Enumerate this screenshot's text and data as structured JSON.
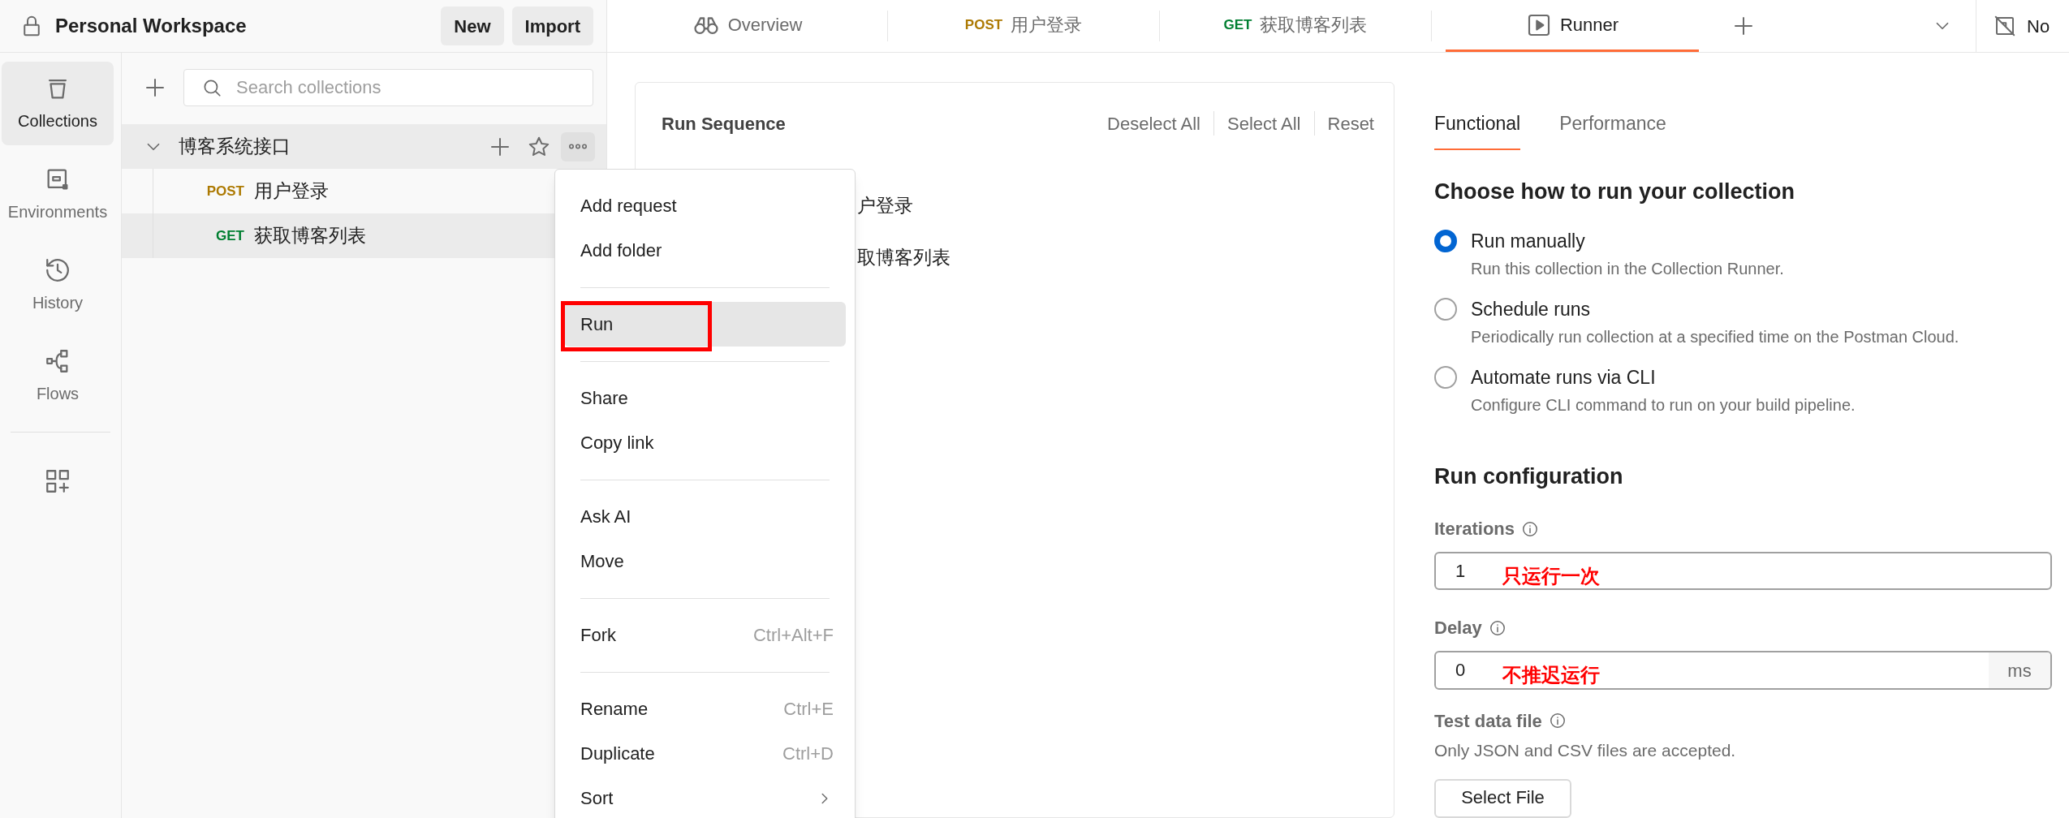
{
  "workspace": {
    "title": "Personal Workspace",
    "buttons": [
      "New",
      "Import"
    ]
  },
  "tabs": [
    {
      "kind": "overview",
      "label": "Overview",
      "selected": false
    },
    {
      "kind": "request",
      "method": "POST",
      "label": "用户登录",
      "selected": false
    },
    {
      "kind": "request",
      "method": "GET",
      "label": "获取博客列表",
      "selected": false
    },
    {
      "kind": "runner",
      "label": "Runner",
      "selected": true
    }
  ],
  "environment": {
    "label": "No"
  },
  "sidebar": {
    "items": [
      {
        "kind": "collections",
        "label": "Collections",
        "selected": true
      },
      {
        "kind": "environments",
        "label": "Environments",
        "selected": false
      },
      {
        "kind": "history",
        "label": "History",
        "selected": false
      },
      {
        "kind": "flows",
        "label": "Flows",
        "selected": false
      },
      {
        "kind": "apps",
        "selected": false
      }
    ]
  },
  "collections": {
    "search": {
      "placeholder": "Search collections"
    },
    "tree": [
      {
        "name": "博客系统接口",
        "expanded": true,
        "selected": true,
        "children": [
          {
            "method": "POST",
            "name": "用户登录",
            "selected": false
          },
          {
            "method": "GET",
            "name": "获取博客列表",
            "selected": true
          }
        ]
      }
    ]
  },
  "context_menu": {
    "groups": [
      [
        {
          "label": "Add request",
          "highlighted": false,
          "marked": false
        },
        {
          "label": "Add folder",
          "highlighted": false,
          "marked": false
        }
      ],
      [
        {
          "label": "Run",
          "highlighted": true,
          "marked": true
        }
      ],
      [
        {
          "label": "Share",
          "highlighted": false,
          "marked": false
        },
        {
          "label": "Copy link",
          "highlighted": false,
          "marked": false
        }
      ],
      [
        {
          "label": "Ask AI",
          "highlighted": false,
          "marked": false
        },
        {
          "label": "Move",
          "highlighted": false,
          "marked": false
        }
      ],
      [
        {
          "label": "Fork",
          "shortcut": "Ctrl+Alt+F",
          "highlighted": false,
          "marked": false
        }
      ],
      [
        {
          "label": "Rename",
          "shortcut": "Ctrl+E",
          "highlighted": false,
          "marked": false
        },
        {
          "label": "Duplicate",
          "shortcut": "Ctrl+D",
          "highlighted": false,
          "marked": false
        },
        {
          "label": "Sort",
          "submenu": true,
          "highlighted": false,
          "marked": false
        }
      ]
    ]
  },
  "run_sequence": {
    "title": "Run Sequence",
    "actions": [
      "Deselect All",
      "Select All",
      "Reset"
    ],
    "items": [
      "户登录",
      "取博客列表"
    ]
  },
  "runner": {
    "tabs": [
      {
        "label": "Functional",
        "selected": true
      },
      {
        "label": "Performance",
        "selected": false
      }
    ],
    "heading": "Choose how to run your collection",
    "options": [
      {
        "label": "Run manually",
        "description": "Run this collection in the Collection Runner.",
        "selected": true
      },
      {
        "label": "Schedule runs",
        "description": "Periodically run collection at a specified time on the Postman Cloud.",
        "selected": false
      },
      {
        "label": "Automate runs via CLI",
        "description": "Configure CLI command to run on your build pipeline.",
        "selected": false
      }
    ],
    "config": {
      "title": "Run configuration",
      "fields": [
        {
          "label": "Iterations",
          "value": "1",
          "note": "只运行一次"
        },
        {
          "label": "Delay",
          "value": "0",
          "note": "不推迟运行",
          "unit": "ms"
        }
      ],
      "test_data": {
        "label": "Test data file",
        "hint": "Only JSON and CSV files are accepted.",
        "button": "Select File"
      }
    }
  }
}
